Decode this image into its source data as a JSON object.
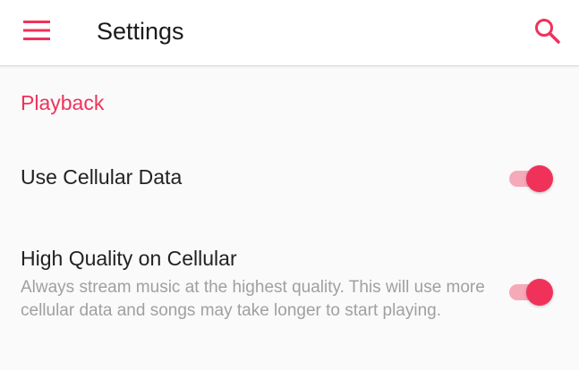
{
  "app_bar": {
    "title": "Settings",
    "menu_icon": "hamburger-menu-icon",
    "search_icon": "search-icon"
  },
  "colors": {
    "accent": "#f0325a",
    "track_on": "#f6a9b9",
    "title_text": "#1a1a1a",
    "secondary_text": "#a0a0a0",
    "background": "#fafafa",
    "app_bar_bg": "#ffffff"
  },
  "section": {
    "header": "Playback"
  },
  "settings": [
    {
      "title": "Use Cellular Data",
      "subtitle": "",
      "enabled": true
    },
    {
      "title": "High Quality on Cellular",
      "subtitle": "Always stream music at the highest quality. This will use more cellular data and songs may take longer to start playing.",
      "enabled": true
    }
  ]
}
